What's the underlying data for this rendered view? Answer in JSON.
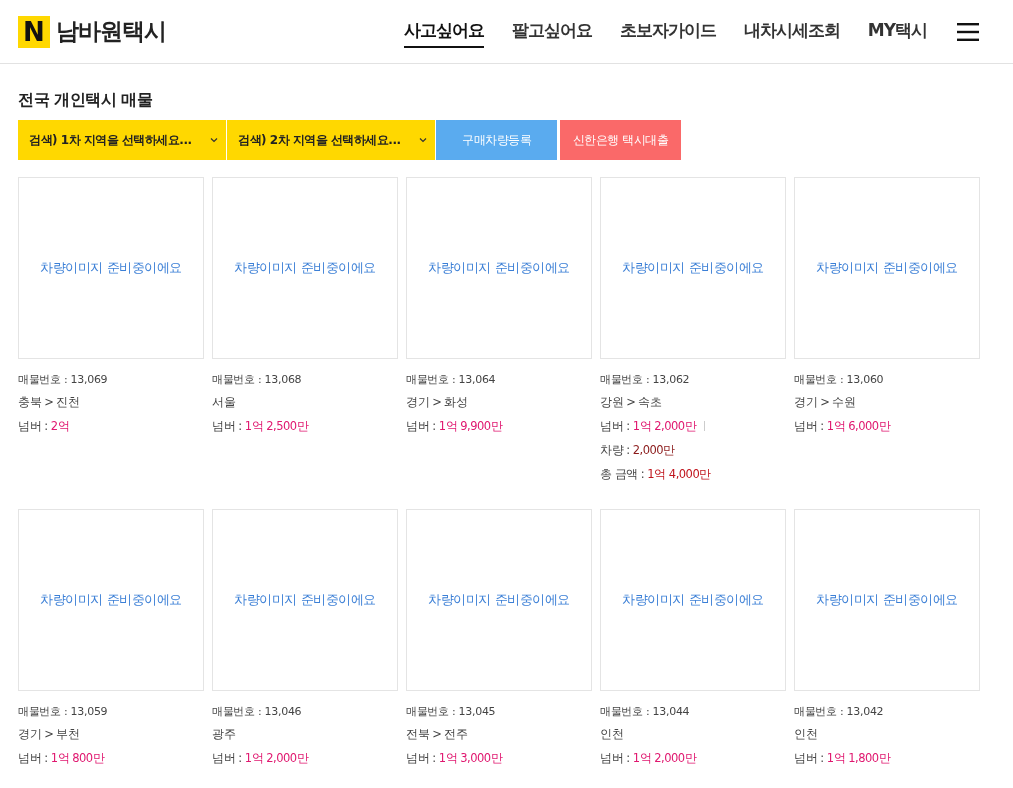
{
  "logo": {
    "mark": "N",
    "name": "남바원택시"
  },
  "nav": [
    {
      "label": "사고싶어요",
      "selected": true
    },
    {
      "label": "팔고싶어요",
      "selected": false
    },
    {
      "label": "초보자가이드",
      "selected": false
    },
    {
      "label": "내차시세조회",
      "selected": false
    },
    {
      "label": "MY택시",
      "selected": false
    }
  ],
  "page_title": "전국 개인택시 매물",
  "filters": [
    {
      "kind": "select",
      "label": "검색)  1차 지역을 선택하세요..."
    },
    {
      "kind": "select",
      "label": "검색)  2차 지역을 선택하세요..."
    },
    {
      "kind": "register",
      "label": "구매차량등록"
    },
    {
      "kind": "loan",
      "label": "신한은행 택시대출"
    }
  ],
  "listings": [
    {
      "image_text": "차량이미지 준비중이에요",
      "number": "매물번호 : 13,069",
      "region": "충북 > 진천",
      "prices": [
        {
          "kind": "plate",
          "label": "넘버 : ",
          "value": "2억"
        }
      ]
    },
    {
      "image_text": "차량이미지 준비중이에요",
      "number": "매물번호 : 13,068",
      "region": "서울",
      "prices": [
        {
          "kind": "plate",
          "label": "넘버 : ",
          "value": "1억 2,500만"
        }
      ]
    },
    {
      "image_text": "차량이미지 준비중이에요",
      "number": "매물번호 : 13,064",
      "region": "경기 > 화성",
      "prices": [
        {
          "kind": "plate",
          "label": "넘버 : ",
          "value": "1억 9,900만"
        }
      ]
    },
    {
      "image_text": "차량이미지 준비중이에요",
      "number": "매물번호 : 13,062",
      "region": "강원 > 속초",
      "prices": [
        {
          "kind": "plate",
          "label": "넘버 : ",
          "value": "1억 2,000만"
        },
        {
          "kind": "car",
          "label": "차량 : ",
          "value": "2,000만"
        },
        {
          "kind": "total",
          "label": "총 금액 : ",
          "value": "1억 4,000만"
        }
      ]
    },
    {
      "image_text": "차량이미지 준비중이에요",
      "number": "매물번호 : 13,060",
      "region": "경기 > 수원",
      "prices": [
        {
          "kind": "plate",
          "label": "넘버 : ",
          "value": "1억 6,000만"
        }
      ]
    },
    {
      "image_text": "차량이미지 준비중이에요",
      "number": "매물번호 : 13,059",
      "region": "경기 > 부천",
      "prices": [
        {
          "kind": "plate",
          "label": "넘버 : ",
          "value": "1억 800만"
        }
      ]
    },
    {
      "image_text": "차량이미지 준비중이에요",
      "number": "매물번호 : 13,046",
      "region": "광주",
      "prices": [
        {
          "kind": "plate",
          "label": "넘버 : ",
          "value": "1억 2,000만"
        }
      ]
    },
    {
      "image_text": "차량이미지 준비중이에요",
      "number": "매물번호 : 13,045",
      "region": "전북 > 전주",
      "prices": [
        {
          "kind": "plate",
          "label": "넘버 : ",
          "value": "1억 3,000만"
        }
      ]
    },
    {
      "image_text": "차량이미지 준비중이에요",
      "number": "매물번호 : 13,044",
      "region": "인천",
      "prices": [
        {
          "kind": "plate",
          "label": "넘버 : ",
          "value": "1억 2,000만"
        }
      ]
    },
    {
      "image_text": "차량이미지 준비중이에요",
      "number": "매물번호 : 13,042",
      "region": "인천",
      "prices": [
        {
          "kind": "plate",
          "label": "넘버 : ",
          "value": "1억 1,800만"
        }
      ]
    }
  ]
}
